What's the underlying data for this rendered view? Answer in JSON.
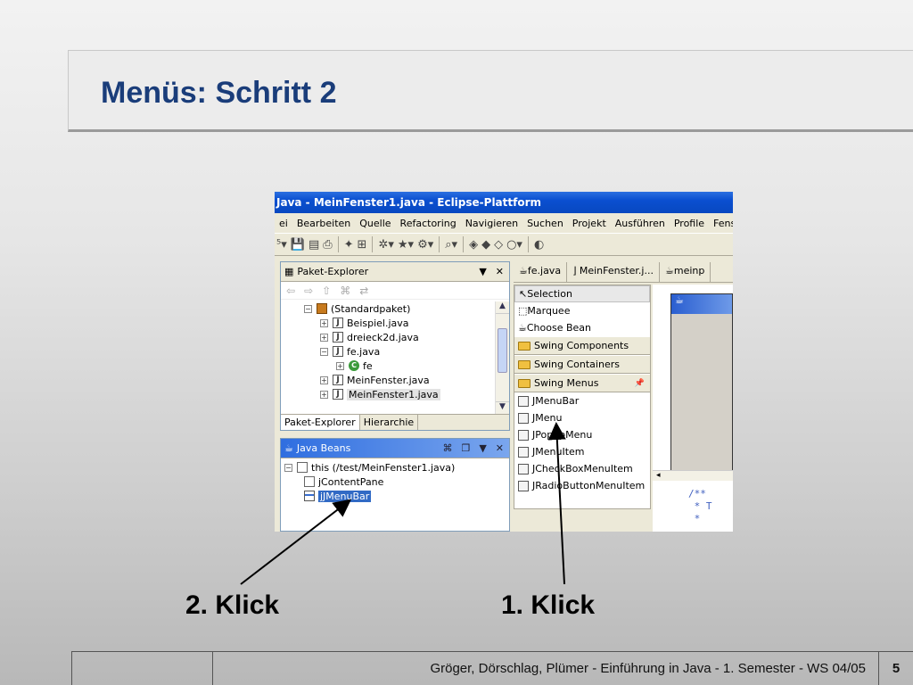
{
  "slide": {
    "title": "Menüs: Schritt 2",
    "label_click2": "2. Klick",
    "label_click1": "1. Klick",
    "footer_text": "Gröger, Dörschlag, Plümer -  Einführung in Java  -  1. Semester  -  WS 04/05",
    "page_number": "5"
  },
  "eclipse": {
    "window_title": "Java - MeinFenster1.java - Eclipse-Plattform",
    "menu": [
      "ei",
      "Bearbeiten",
      "Quelle",
      "Refactoring",
      "Navigieren",
      "Suchen",
      "Projekt",
      "Ausführen",
      "Profile",
      "Fenster"
    ],
    "package_explorer": {
      "title": "Paket-Explorer",
      "tree": [
        {
          "label": "(Standardpaket)",
          "expander": "−",
          "indent": 0,
          "icon": "package"
        },
        {
          "label": "Beispiel.java",
          "expander": "+",
          "indent": 1,
          "icon": "java-file"
        },
        {
          "label": "dreieck2d.java",
          "expander": "+",
          "indent": 1,
          "icon": "java-file"
        },
        {
          "label": "fe.java",
          "expander": "−",
          "indent": 1,
          "icon": "java-file"
        },
        {
          "label": "fe",
          "expander": "+",
          "indent": 2,
          "icon": "class"
        },
        {
          "label": "MeinFenster.java",
          "expander": "+",
          "indent": 1,
          "icon": "java-file"
        },
        {
          "label": "MeinFenster1.java",
          "expander": "+",
          "indent": 1,
          "icon": "java-file",
          "selected": true
        }
      ],
      "tabs": [
        "Paket-Explorer",
        "Hierarchie"
      ]
    },
    "java_beans": {
      "title": "Java Beans",
      "tree": [
        {
          "label": "this (/test/MeinFenster1.java)",
          "indent": 0,
          "expander": "−",
          "icon": "frame"
        },
        {
          "label": "jContentPane",
          "indent": 1,
          "icon": "box"
        },
        {
          "label": "jJMenuBar",
          "indent": 1,
          "icon": "menubar",
          "selected": true
        }
      ]
    },
    "editor_tabs": [
      "fe.java",
      "MeinFenster.j...",
      "meinp"
    ],
    "palette": {
      "tools": [
        "Selection",
        "Marquee",
        "Choose Bean"
      ],
      "categories": [
        "Swing Components",
        "Swing Containers",
        "Swing Menus"
      ],
      "menu_items": [
        "JMenuBar",
        "JMenu",
        "JPopupMenu",
        "JMenuItem",
        "JCheckBoxMenuItem",
        "JRadioButtonMenuItem"
      ]
    },
    "code_lines": [
      "/**",
      " * T",
      " *"
    ]
  }
}
